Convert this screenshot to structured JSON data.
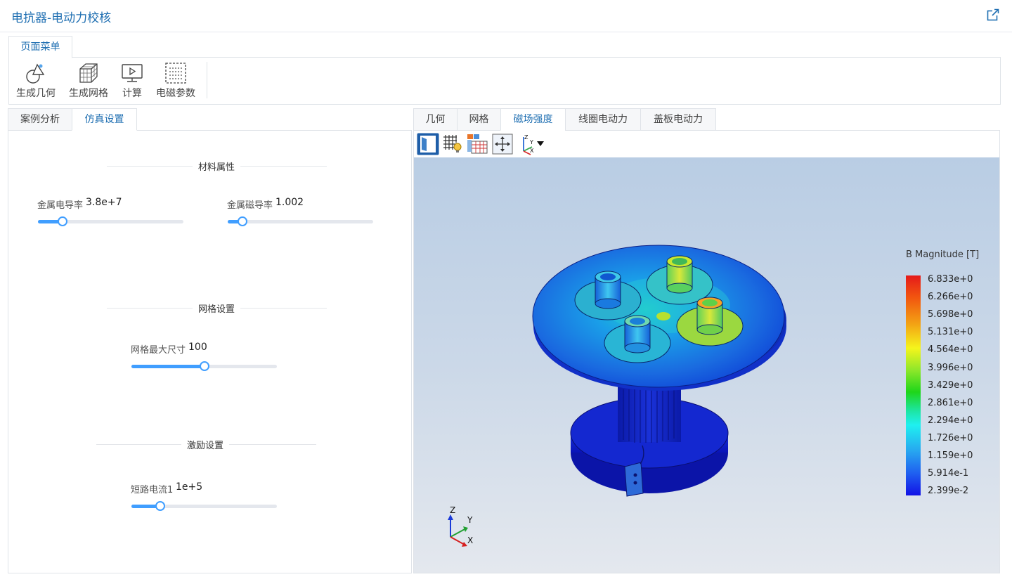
{
  "window": {
    "title": "电抗器-电动力校核",
    "external_icon": "external-link-icon"
  },
  "menu": {
    "tab_label": "页面菜单",
    "tools": [
      {
        "label": "生成几何",
        "icon": "geometry-icon"
      },
      {
        "label": "生成网格",
        "icon": "mesh-cube-icon"
      },
      {
        "label": "计算",
        "icon": "monitor-play-icon"
      },
      {
        "label": "电磁参数",
        "icon": "parameter-grid-icon"
      }
    ]
  },
  "left": {
    "tabs": [
      {
        "label": "案例分析"
      },
      {
        "label": "仿真设置",
        "active": true
      }
    ],
    "sections": {
      "material": {
        "title": "材料属性",
        "params": [
          {
            "label": "金属电导率",
            "value": "3.8e+7",
            "fraction": 0.17
          },
          {
            "label": "金属磁导率",
            "value": "1.002",
            "fraction": 0.1
          }
        ]
      },
      "mesh": {
        "title": "网格设置",
        "params": [
          {
            "label": "网格最大尺寸",
            "value": "100",
            "fraction": 0.5
          }
        ]
      },
      "excitation": {
        "title": "激励设置",
        "params": [
          {
            "label": "短路电流1",
            "value": "1e+5",
            "fraction": 0.2
          }
        ]
      }
    }
  },
  "right": {
    "tabs": [
      {
        "label": "几何"
      },
      {
        "label": "网格"
      },
      {
        "label": "磁场强度",
        "active": true
      },
      {
        "label": "线圈电动力"
      },
      {
        "label": "盖板电动力"
      }
    ],
    "viewer_tools": [
      "view-panel-icon",
      "mesh-light-icon",
      "table-grid-icon",
      "fit-view-icon",
      "axes-orientation-icon"
    ],
    "legend": {
      "title": "B Magnitude [T]",
      "labels": [
        "6.833e+0",
        "6.266e+0",
        "5.698e+0",
        "5.131e+0",
        "4.564e+0",
        "3.996e+0",
        "3.429e+0",
        "2.861e+0",
        "2.294e+0",
        "1.726e+0",
        "1.159e+0",
        "5.914e-1",
        "2.399e-2"
      ]
    },
    "axes": {
      "x": "X",
      "y": "Y",
      "z": "Z"
    }
  }
}
